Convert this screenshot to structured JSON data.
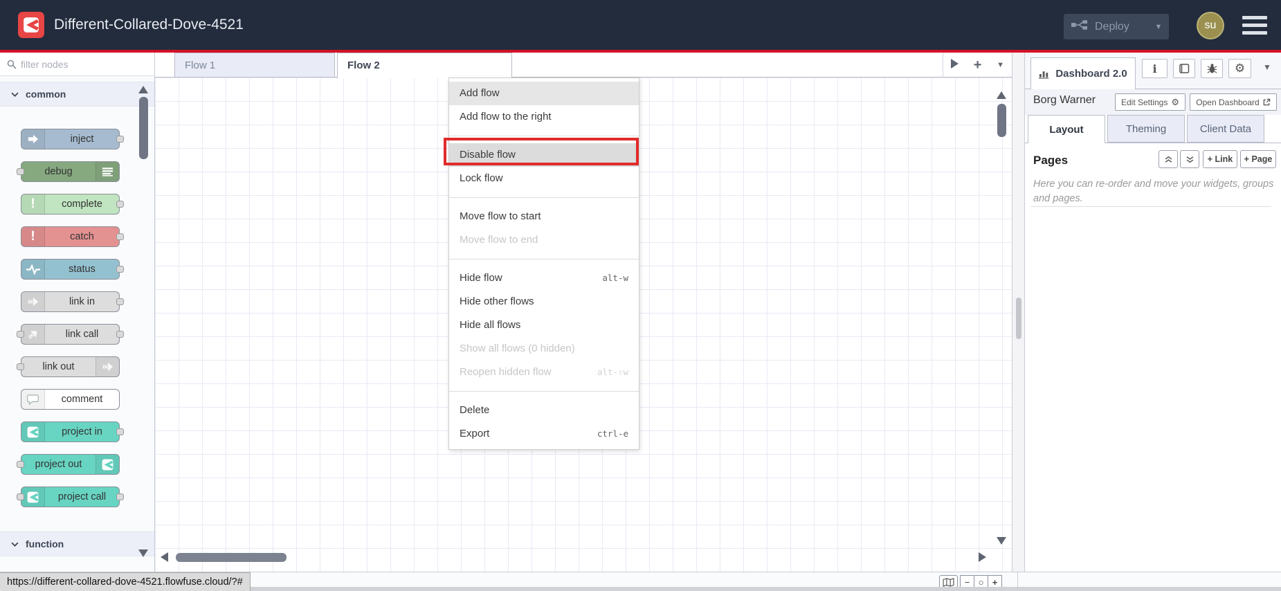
{
  "header": {
    "title": "Different-Collared-Dove-4521",
    "deploy_label": "Deploy",
    "avatar_text": "su",
    "logo_icon": "flowfuse-logo-icon",
    "menu_icon": "hamburger-icon",
    "colors": {
      "bar": "#222c3d",
      "accent_line": "#d41227",
      "logo": "#e84545",
      "avatar_bg": "#9b9050"
    }
  },
  "palette": {
    "search_placeholder": "filter nodes",
    "search_icon": "search-icon",
    "category_common": "common",
    "category_function": "function",
    "nodes": [
      {
        "label": "inject",
        "color": "#a6bbcf",
        "icon": "inject-arrow-icon",
        "icon_side": "left",
        "ports": "right"
      },
      {
        "label": "debug",
        "color": "#87a980",
        "icon": "debug-lines-icon",
        "icon_side": "right",
        "ports": "left"
      },
      {
        "label": "complete",
        "color": "#c0e5c0",
        "icon": "exclamation-icon",
        "icon_side": "left",
        "ports": "right"
      },
      {
        "label": "catch",
        "color": "#e49191",
        "icon": "exclamation-icon",
        "icon_side": "left",
        "ports": "right"
      },
      {
        "label": "status",
        "color": "#94c1d0",
        "icon": "status-pulse-icon",
        "icon_side": "left",
        "ports": "right"
      },
      {
        "label": "link in",
        "color": "#dddddd",
        "icon": "link-arrow-icon",
        "icon_side": "left",
        "ports": "right"
      },
      {
        "label": "link call",
        "color": "#dddddd",
        "icon": "link-call-icon",
        "icon_side": "left",
        "ports": "both"
      },
      {
        "label": "link out",
        "color": "#dddddd",
        "icon": "link-arrow-icon",
        "icon_side": "right",
        "ports": "left"
      },
      {
        "label": "comment",
        "color": "#ffffff",
        "icon": "comment-bubble-icon",
        "icon_side": "left",
        "ports": "none"
      },
      {
        "label": "project in",
        "color": "#68d4c2",
        "icon": "flowfuse-icon",
        "icon_side": "left",
        "ports": "right"
      },
      {
        "label": "project out",
        "color": "#68d4c2",
        "icon": "flowfuse-icon",
        "icon_side": "right",
        "ports": "left"
      },
      {
        "label": "project call",
        "color": "#68d4c2",
        "icon": "flowfuse-icon",
        "icon_side": "left",
        "ports": "both"
      }
    ]
  },
  "workspace": {
    "tabs": [
      {
        "label": "Flow 1",
        "active": false
      },
      {
        "label": "Flow 2",
        "active": true
      }
    ]
  },
  "context_menu": {
    "highlight_color": "#e12b2b",
    "items": [
      {
        "label": "Add flow",
        "state": "hover"
      },
      {
        "label": "Add flow to the right"
      },
      {
        "type": "separator"
      },
      {
        "label": "Disable flow",
        "state": "highlight"
      },
      {
        "label": "Lock flow"
      },
      {
        "type": "separator"
      },
      {
        "label": "Move flow to start"
      },
      {
        "label": "Move flow to end",
        "state": "disabled"
      },
      {
        "type": "separator"
      },
      {
        "label": "Hide flow",
        "shortcut": "alt-w"
      },
      {
        "label": "Hide other flows"
      },
      {
        "label": "Hide all flows"
      },
      {
        "label": "Show all flows (0 hidden)",
        "state": "disabled"
      },
      {
        "label": "Reopen hidden flow",
        "shortcut": "alt-⇧w",
        "state": "disabled"
      },
      {
        "type": "separator"
      },
      {
        "label": "Delete"
      },
      {
        "label": "Export",
        "shortcut": "ctrl-e"
      }
    ]
  },
  "sidebar": {
    "tab_label": "Dashboard 2.0",
    "tab_icon": "bar-chart-icon",
    "toolbar_icons": [
      "info-icon",
      "book-icon",
      "bug-icon",
      "gear-icon",
      "chevron-down-icon"
    ],
    "project_name": "Borg Warner",
    "edit_settings_label": "Edit Settings",
    "open_dashboard_label": "Open Dashboard",
    "tabs": [
      "Layout",
      "Theming",
      "Client Data"
    ],
    "pages_title": "Pages",
    "move_up_icon": "double-chevron-up-icon",
    "move_down_icon": "double-chevron-down-icon",
    "link_button": "+ Link",
    "page_button": "+ Page",
    "help_text": "Here you can re-order and move your widgets, groups and pages."
  },
  "footer": {
    "status_url": "https://different-collared-dove-4521.flowfuse.cloud/?#",
    "map_icon": "mini-map-icon",
    "zoom_out": "−",
    "zoom_reset": "○",
    "zoom_in": "+"
  }
}
